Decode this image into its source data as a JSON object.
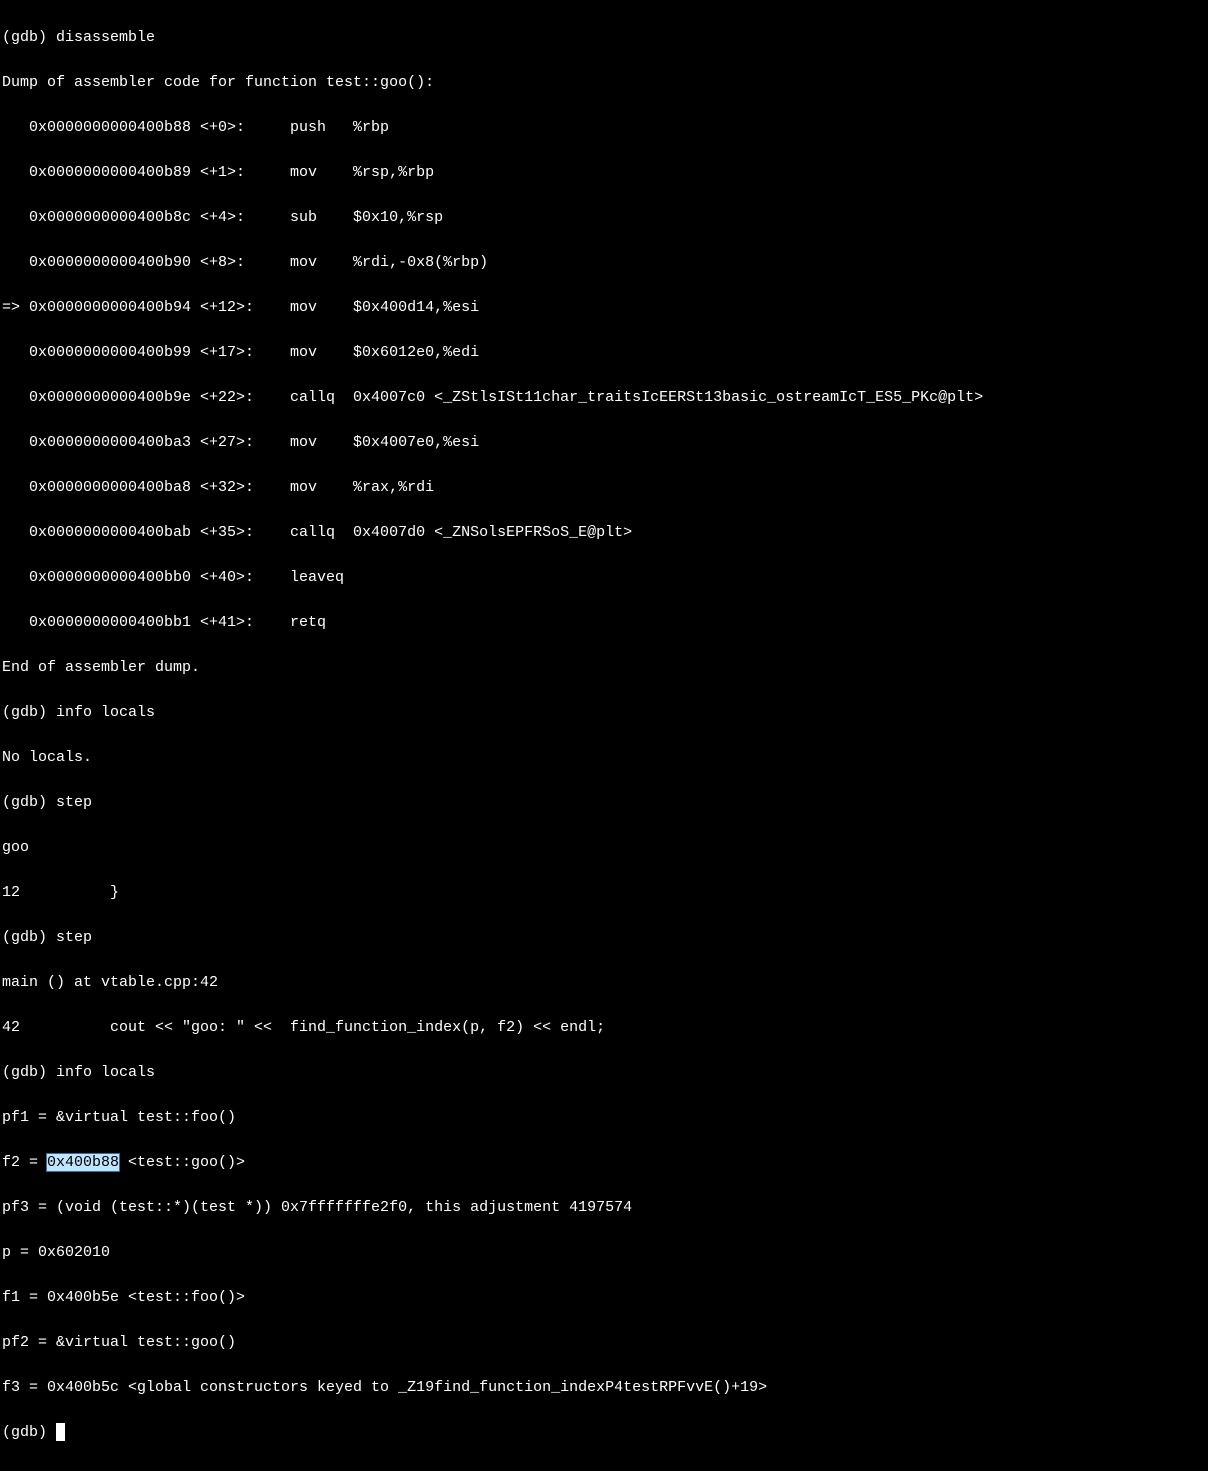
{
  "terminal": {
    "lines": [
      "(gdb) disassemble",
      "Dump of assembler code for function test::goo():",
      "   0x0000000000400b88 <+0>:     push   %rbp",
      "   0x0000000000400b89 <+1>:     mov    %rsp,%rbp",
      "   0x0000000000400b8c <+4>:     sub    $0x10,%rsp",
      "   0x0000000000400b90 <+8>:     mov    %rdi,-0x8(%rbp)",
      "=> 0x0000000000400b94 <+12>:    mov    $0x400d14,%esi",
      "   0x0000000000400b99 <+17>:    mov    $0x6012e0,%edi",
      "   0x0000000000400b9e <+22>:    callq  0x4007c0 <_ZStlsISt11char_traitsIcEERSt13basic_ostreamIcT_ES5_PKc@plt>",
      "   0x0000000000400ba3 <+27>:    mov    $0x4007e0,%esi",
      "   0x0000000000400ba8 <+32>:    mov    %rax,%rdi",
      "   0x0000000000400bab <+35>:    callq  0x4007d0 <_ZNSolsEPFRSoS_E@plt>",
      "   0x0000000000400bb0 <+40>:    leaveq ",
      "   0x0000000000400bb1 <+41>:    retq   ",
      "End of assembler dump.",
      "(gdb) info locals",
      "No locals.",
      "(gdb) step",
      "goo",
      "12          }",
      "(gdb) step",
      "main () at vtable.cpp:42",
      "42          cout << \"goo: \" <<  find_function_index(p, f2) << endl;",
      "(gdb) info locals",
      "pf1 = &virtual test::foo()"
    ],
    "highlighted_line": {
      "prefix": "f2 = ",
      "highlighted": "0x400b88",
      "suffix": " <test::goo()>"
    },
    "lines_after": [
      "pf3 = (void (test::*)(test *)) 0x7fffffffe2f0, this adjustment 4197574",
      "p = 0x602010",
      "f1 = 0x400b5e <test::foo()>",
      "pf2 = &virtual test::goo()",
      "f3 = 0x400b5c <global constructors keyed to _Z19find_function_indexP4testRPFvvE()+19>"
    ],
    "prompt": "(gdb) "
  }
}
